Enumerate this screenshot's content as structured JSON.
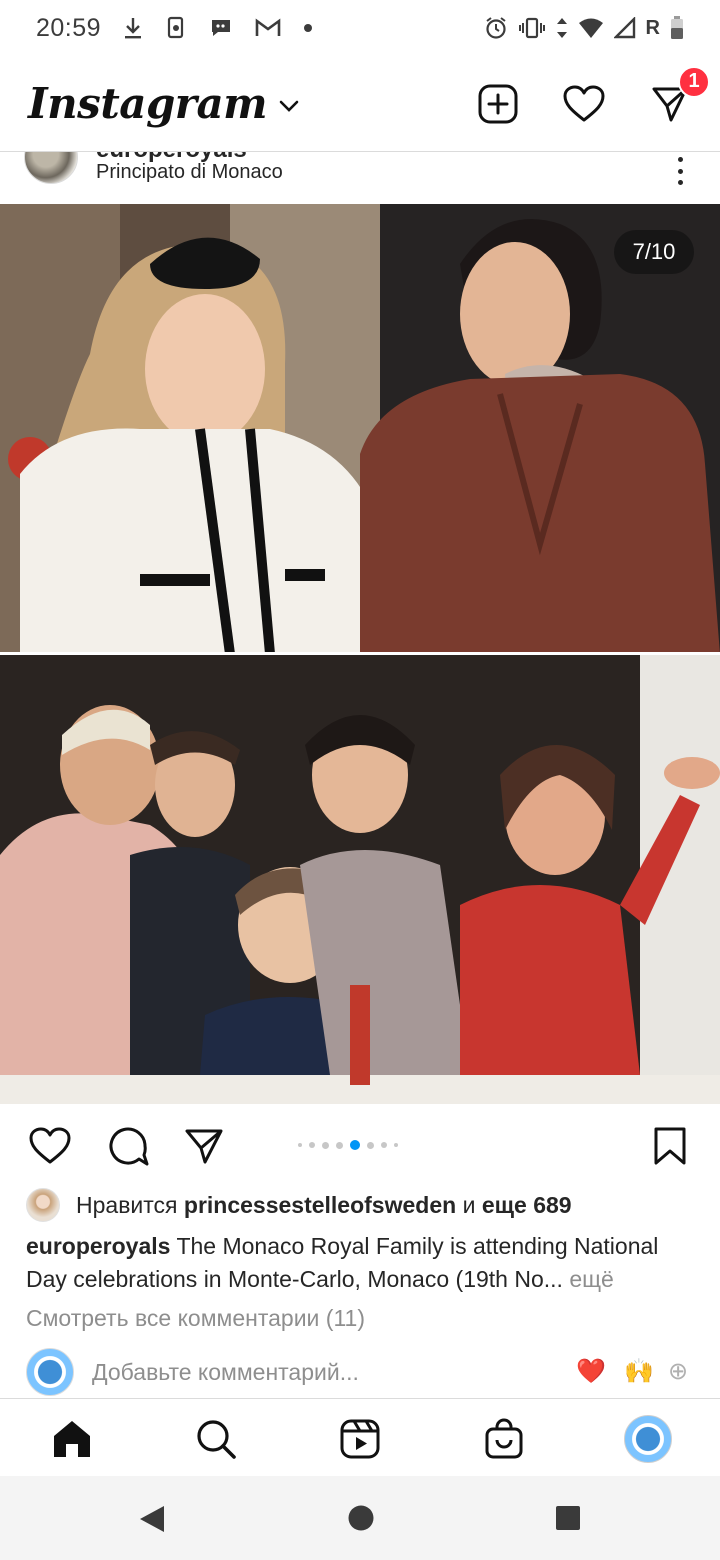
{
  "status_bar": {
    "time": "20:59",
    "carrier_letter": "R"
  },
  "header": {
    "logo": "Instagram",
    "notification_count": "1"
  },
  "post": {
    "username": "europeroyals",
    "location": "Principato di Monaco",
    "page_indicator": "7/10",
    "carousel": {
      "total_dots": 8,
      "active_dot": 5
    },
    "likes": {
      "prefix": "Нравится",
      "liked_by": "princessestelleofsweden",
      "connector": "и",
      "others": "еще 689"
    },
    "caption": {
      "username": "europeroyals",
      "text": "The Monaco Royal Family is attending National Day celebrations in Monte-Carlo, Monaco (19th No...",
      "more": "ещё"
    },
    "view_comments": "Смотреть все комментарии (11)",
    "comment_placeholder": "Добавьте комментарий...",
    "quick_emojis": [
      "❤️",
      "🙌",
      "⊕"
    ]
  },
  "colors": {
    "accent_red": "#ff3040",
    "active_dot": "#0095f6",
    "text": "#262626",
    "muted": "#8e8e8e"
  },
  "icons": {
    "header": [
      "new-post-icon",
      "heart-icon",
      "direct-message-icon"
    ],
    "actions": [
      "like-icon",
      "comment-icon",
      "share-icon",
      "save-bookmark-icon"
    ],
    "nav": [
      "home-icon",
      "search-icon",
      "reels-icon",
      "shop-icon",
      "profile-avatar"
    ],
    "system": [
      "back-icon",
      "home-circle-icon",
      "recents-icon"
    ]
  }
}
